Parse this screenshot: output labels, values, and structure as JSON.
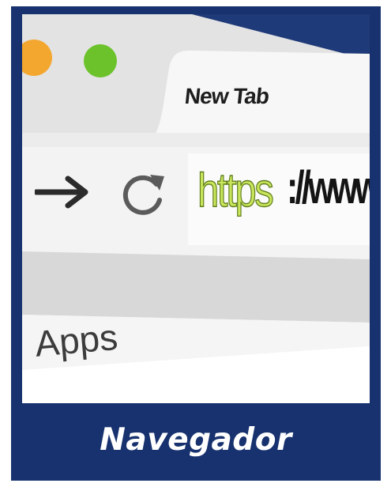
{
  "browser": {
    "tab_title": "New Tab",
    "url_scheme": "https",
    "url_rest": "://www",
    "bookmarks_label": "Apps"
  },
  "icons": [
    "forward-arrow-icon",
    "reload-icon"
  ],
  "caption": "Navegador",
  "colors": {
    "card_blue": "#17326e",
    "https_green": "#c9e55b",
    "dot_orange": "#f4a72f",
    "dot_green": "#6bc22a"
  }
}
